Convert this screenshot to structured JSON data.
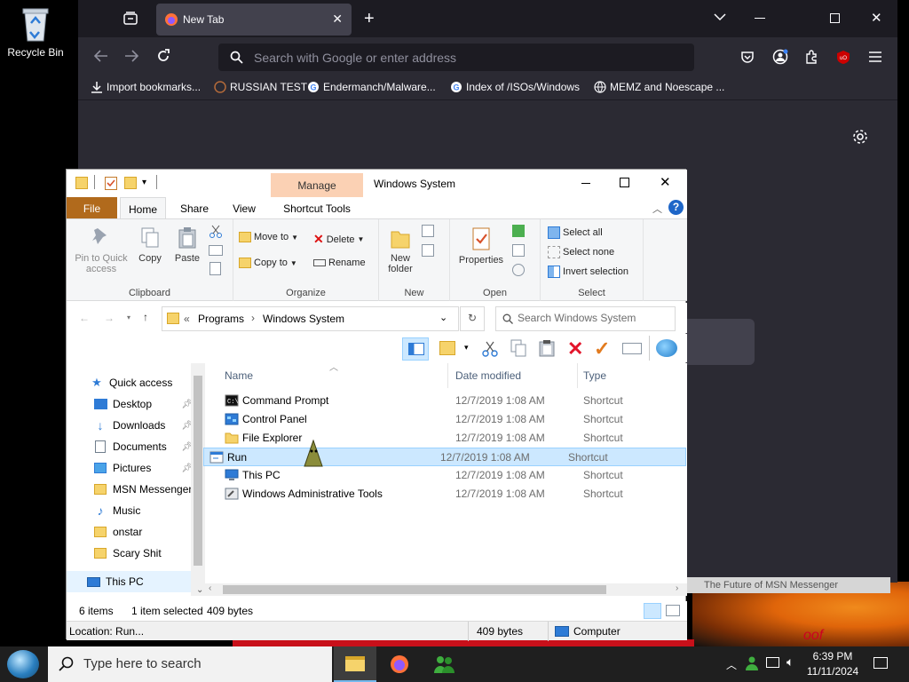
{
  "desktop": {
    "recycle_bin_label": "Recycle Bin",
    "wallpaper_text": "oof"
  },
  "firefox": {
    "tab_title": "New Tab",
    "url_placeholder": "Search with Google or enter address",
    "bookmarks": [
      {
        "label": "Import bookmarks...",
        "icon": "import-icon"
      },
      {
        "label": "RUSSIAN TEST",
        "icon": "globe-icon"
      },
      {
        "label": "Endermanch/Malware...",
        "icon": "google-icon"
      },
      {
        "label": "Index of /ISOs/Windows",
        "icon": "google-icon"
      },
      {
        "label": "MEMZ and Noescape ...",
        "icon": "globe-icon"
      }
    ]
  },
  "explorer": {
    "title": "Windows System",
    "manage_label": "Manage",
    "tabs": {
      "file": "File",
      "home": "Home",
      "share": "Share",
      "view": "View",
      "shortcut_tools": "Shortcut Tools"
    },
    "ribbon": {
      "clipboard": {
        "pin": "Pin to Quick access",
        "copy": "Copy",
        "paste": "Paste",
        "group": "Clipboard"
      },
      "organize": {
        "move_to": "Move to",
        "copy_to": "Copy to",
        "delete": "Delete",
        "rename": "Rename",
        "group": "Organize"
      },
      "new": {
        "new_folder": "New folder",
        "group": "New"
      },
      "open": {
        "properties": "Properties",
        "group": "Open"
      },
      "select": {
        "select_all": "Select all",
        "select_none": "Select none",
        "invert": "Invert selection",
        "group": "Select"
      }
    },
    "address": {
      "sep": "«",
      "crumb1": "Programs",
      "crumb2": "Windows System"
    },
    "search_placeholder": "Search Windows System",
    "nav": [
      {
        "label": "Quick access",
        "icon": "star-icon",
        "pinned": false
      },
      {
        "label": "Desktop",
        "icon": "desktop-icon",
        "pinned": true
      },
      {
        "label": "Downloads",
        "icon": "download-icon",
        "pinned": true
      },
      {
        "label": "Documents",
        "icon": "documents-icon",
        "pinned": true
      },
      {
        "label": "Pictures",
        "icon": "pictures-icon",
        "pinned": true
      },
      {
        "label": "MSN Messenger",
        "icon": "folder-icon",
        "pinned": false
      },
      {
        "label": "Music",
        "icon": "music-icon",
        "pinned": false
      },
      {
        "label": "onstar",
        "icon": "folder-icon",
        "pinned": false
      },
      {
        "label": "Scary Shit",
        "icon": "folder-icon",
        "pinned": false
      },
      {
        "label": "This PC",
        "icon": "computer-icon",
        "pinned": false
      }
    ],
    "columns": {
      "name": "Name",
      "date": "Date modified",
      "type": "Type"
    },
    "files": [
      {
        "name": "Command Prompt",
        "date": "12/7/2019 1:08 AM",
        "type": "Shortcut",
        "icon": "cmd-icon",
        "selected": false
      },
      {
        "name": "Control Panel",
        "date": "12/7/2019 1:08 AM",
        "type": "Shortcut",
        "icon": "control-panel-icon",
        "selected": false
      },
      {
        "name": "File Explorer",
        "date": "12/7/2019 1:08 AM",
        "type": "Shortcut",
        "icon": "folder-icon",
        "selected": false
      },
      {
        "name": "Run",
        "date": "12/7/2019 1:08 AM",
        "type": "Shortcut",
        "icon": "run-icon",
        "selected": true
      },
      {
        "name": "This PC",
        "date": "12/7/2019 1:08 AM",
        "type": "Shortcut",
        "icon": "computer-icon",
        "selected": false
      },
      {
        "name": "Windows Administrative Tools",
        "date": "12/7/2019 1:08 AM",
        "type": "Shortcut",
        "icon": "admin-tools-icon",
        "selected": false
      }
    ],
    "status": {
      "count": "6 items",
      "selection": "1 item selected",
      "size": "409 bytes"
    },
    "location": {
      "text": "Location: Run...",
      "size": "409 bytes",
      "zone": "Computer"
    }
  },
  "msn_strip_text": "The Future of MSN Messenger",
  "taskbar": {
    "search_placeholder": "Type here to search",
    "time": "6:39 PM",
    "date": "11/11/2024"
  },
  "colors": {
    "ff_bg": "#2b2a33",
    "file_tab": "#b16a1c",
    "manage_tab": "#fbd1b4",
    "selection": "#cce8ff",
    "taskbar": "#1f1f1f"
  }
}
